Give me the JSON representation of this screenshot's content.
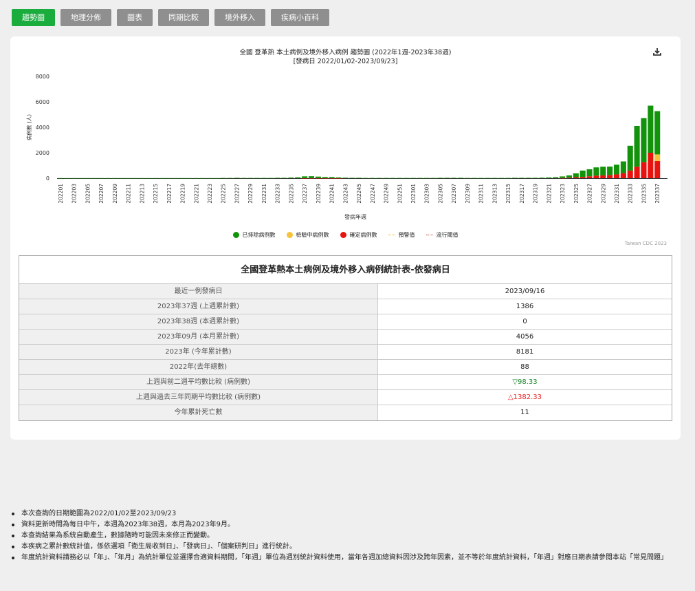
{
  "tabs": [
    {
      "label": "趨勢圖",
      "active": true
    },
    {
      "label": "地理分佈",
      "active": false
    },
    {
      "label": "圖表",
      "active": false
    },
    {
      "label": "同期比較",
      "active": false
    },
    {
      "label": "境外移入",
      "active": false
    },
    {
      "label": "疾病小百科",
      "active": false
    }
  ],
  "chart": {
    "title_line1": "全國 登革熱 本土病例及境外移入病例 趨勢圖 (2022年1週-2023年38週)",
    "title_line2": "[發病日 2022/01/02-2023/09/23]",
    "download_icon": "download-icon",
    "credit": "Taiwan CDC 2023"
  },
  "chart_data": {
    "type": "bar",
    "stacked": true,
    "xlabel": "發病年週",
    "ylabel": "病例數 (人)",
    "ylim": [
      0,
      8000
    ],
    "yticks": [
      0,
      2000,
      4000,
      6000,
      8000
    ],
    "grid": false,
    "legend_position": "bottom",
    "tick_labels": [
      "202201",
      "202203",
      "202205",
      "202207",
      "202209",
      "202211",
      "202213",
      "202215",
      "202217",
      "202219",
      "202221",
      "202223",
      "202225",
      "202227",
      "202229",
      "202231",
      "202233",
      "202235",
      "202237",
      "202239",
      "202241",
      "202243",
      "202245",
      "202247",
      "202249",
      "202251",
      "202301",
      "202303",
      "202305",
      "202307",
      "202309",
      "202311",
      "202313",
      "202315",
      "202317",
      "202319",
      "202321",
      "202323",
      "202325",
      "202327",
      "202329",
      "202331",
      "202333",
      "202335",
      "202337"
    ],
    "categories": [
      "202201",
      "202202",
      "202203",
      "202204",
      "202205",
      "202206",
      "202207",
      "202208",
      "202209",
      "202210",
      "202211",
      "202212",
      "202213",
      "202214",
      "202215",
      "202216",
      "202217",
      "202218",
      "202219",
      "202220",
      "202221",
      "202222",
      "202223",
      "202224",
      "202225",
      "202226",
      "202227",
      "202228",
      "202229",
      "202230",
      "202231",
      "202232",
      "202233",
      "202234",
      "202235",
      "202236",
      "202237",
      "202238",
      "202239",
      "202240",
      "202241",
      "202242",
      "202243",
      "202244",
      "202245",
      "202246",
      "202247",
      "202248",
      "202249",
      "202250",
      "202251",
      "202252",
      "202301",
      "202302",
      "202303",
      "202304",
      "202305",
      "202306",
      "202307",
      "202308",
      "202309",
      "202310",
      "202311",
      "202312",
      "202313",
      "202314",
      "202315",
      "202316",
      "202317",
      "202318",
      "202319",
      "202320",
      "202321",
      "202322",
      "202323",
      "202324",
      "202325",
      "202326",
      "202327",
      "202328",
      "202329",
      "202330",
      "202331",
      "202332",
      "202333",
      "202334",
      "202335",
      "202336",
      "202337",
      "202338"
    ],
    "series": [
      {
        "name": "已排除病例數",
        "color": "#13930b",
        "values": [
          10,
          10,
          10,
          10,
          10,
          10,
          10,
          10,
          10,
          10,
          10,
          10,
          10,
          10,
          10,
          10,
          10,
          10,
          10,
          10,
          10,
          10,
          10,
          10,
          20,
          20,
          30,
          20,
          20,
          20,
          20,
          20,
          30,
          30,
          50,
          70,
          140,
          150,
          120,
          90,
          90,
          60,
          40,
          30,
          30,
          20,
          20,
          20,
          20,
          20,
          20,
          20,
          20,
          20,
          20,
          20,
          30,
          30,
          30,
          30,
          20,
          20,
          20,
          20,
          20,
          20,
          20,
          30,
          30,
          30,
          30,
          40,
          60,
          80,
          120,
          180,
          300,
          500,
          550,
          650,
          680,
          660,
          760,
          920,
          1950,
          3210,
          3470,
          3700,
          3400,
          0
        ]
      },
      {
        "name": "檢驗中病例數",
        "color": "#f6c33b",
        "values": [
          0,
          0,
          0,
          0,
          0,
          0,
          0,
          0,
          0,
          0,
          0,
          0,
          0,
          0,
          0,
          0,
          0,
          0,
          0,
          0,
          0,
          0,
          0,
          0,
          0,
          0,
          0,
          0,
          0,
          0,
          0,
          0,
          0,
          0,
          0,
          0,
          0,
          0,
          0,
          0,
          0,
          0,
          0,
          0,
          0,
          0,
          0,
          0,
          0,
          0,
          0,
          0,
          0,
          0,
          0,
          0,
          0,
          0,
          0,
          0,
          0,
          0,
          0,
          0,
          0,
          0,
          0,
          0,
          0,
          0,
          0,
          0,
          0,
          0,
          0,
          0,
          0,
          0,
          0,
          0,
          0,
          0,
          0,
          0,
          0,
          0,
          0,
          0,
          520,
          0
        ]
      },
      {
        "name": "確定病例數",
        "color": "#e8120e",
        "values": [
          0,
          0,
          0,
          0,
          0,
          0,
          0,
          0,
          0,
          0,
          0,
          0,
          0,
          0,
          0,
          0,
          0,
          0,
          0,
          0,
          0,
          0,
          0,
          0,
          0,
          0,
          0,
          0,
          0,
          0,
          0,
          0,
          0,
          0,
          0,
          0,
          5,
          5,
          5,
          5,
          5,
          5,
          0,
          0,
          0,
          0,
          0,
          0,
          0,
          0,
          0,
          0,
          0,
          0,
          0,
          0,
          0,
          0,
          0,
          0,
          0,
          0,
          0,
          0,
          0,
          0,
          0,
          0,
          0,
          0,
          0,
          0,
          0,
          0,
          20,
          40,
          80,
          100,
          150,
          200,
          220,
          250,
          300,
          400,
          600,
          900,
          1250,
          2000,
          1350,
          0
        ]
      }
    ],
    "line_series": [
      {
        "name": "預警值",
        "color": "#f4a825",
        "style": "dotted"
      },
      {
        "name": "流行閾值",
        "color": "#c0392b",
        "style": "dotted"
      }
    ]
  },
  "stats": {
    "title": "全國登革熱本土病例及境外移入病例統計表-依發病日",
    "rows": [
      {
        "label": "最近一例發病日",
        "value": "2023/09/16",
        "tone": ""
      },
      {
        "label": "2023年37週 (上週累計數)",
        "value": "1386",
        "tone": ""
      },
      {
        "label": "2023年38週 (本週累計數)",
        "value": "0",
        "tone": ""
      },
      {
        "label": "2023年09月 (本月累計數)",
        "value": "4056",
        "tone": ""
      },
      {
        "label": "2023年 (今年累計數)",
        "value": "8181",
        "tone": ""
      },
      {
        "label": "2022年(去年總數)",
        "value": "88",
        "tone": ""
      },
      {
        "label": "上週與前二週平均數比較 (病例數)",
        "value": "▽98.33",
        "tone": "down"
      },
      {
        "label": "上週與過去三年同期平均數比較 (病例數)",
        "value": "△1382.33",
        "tone": "up"
      },
      {
        "label": "今年累計死亡數",
        "value": "11",
        "tone": ""
      }
    ]
  },
  "notes": [
    "本次查詢的日期範圍為2022/01/02至2023/09/23",
    "資料更新時間為每日中午，本週為2023年38週，本月為2023年9月。",
    "本查詢結果為系統自動產生，數據隨時可能因未來修正而變動。",
    "本疾病之累計數統計值，係依選項「衛生局收到日」、「發病日」、「個案研判日」進行統計。",
    "年度統計資料請務必以「年」、「年月」為統計單位並選擇合適資料期間，「年週」單位為週別統計資料使用，當年各週加總資料因涉及跨年因素，並不等於年度統計資料，「年週」對應日期表請參閱本站「常見問題」"
  ]
}
